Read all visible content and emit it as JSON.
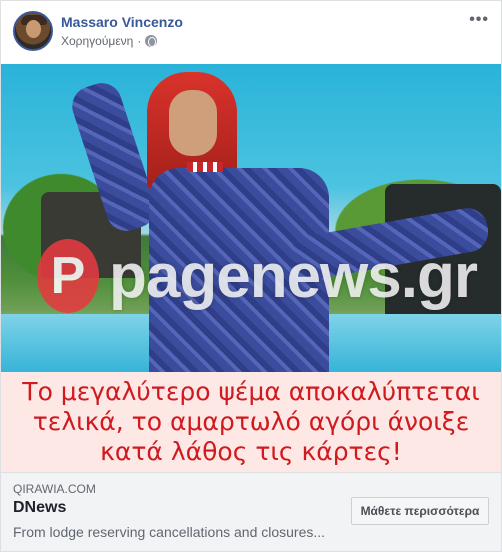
{
  "post": {
    "author": "Massaro Vincenzo",
    "sponsored_label": "Χορηγούμενη",
    "separator": "·",
    "more_icon": "•••"
  },
  "media": {
    "watermark_logo_letter": "P",
    "watermark_text": "pagenews.gr",
    "caption_lines": [
      "Το μεγαλύτερο ψέμα αποκαλύπτεται",
      "τελικά, το αμαρτωλό αγόρι άνοιξε",
      "κατά λάθος τις κάρτες!"
    ]
  },
  "link": {
    "domain": "QIRAWIA.COM",
    "title": "DNews",
    "description": "From lodge reserving cancellations and closures...",
    "cta_label": "Μάθετε περισσότερα"
  },
  "colors": {
    "name_blue": "#385898",
    "caption_red": "#d01a1f",
    "caption_bg": "#fde8e5",
    "watermark_red": "#e53a40"
  }
}
